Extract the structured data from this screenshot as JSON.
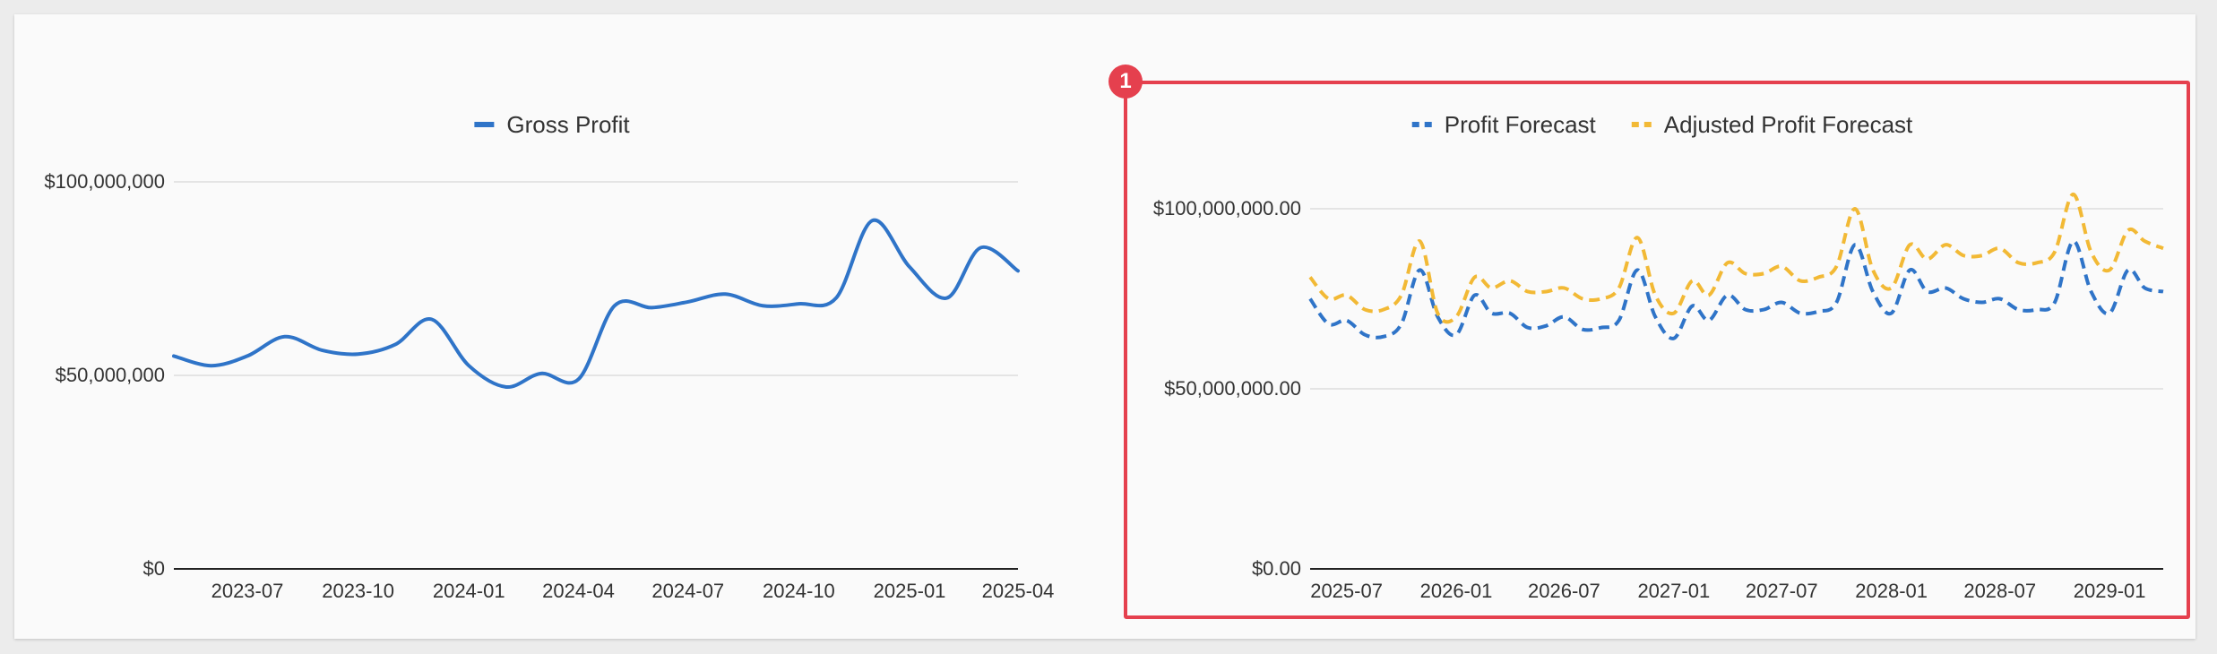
{
  "colors": {
    "gross_profit": "#2f74c8",
    "profit_forecast": "#2f74c8",
    "adjusted_profit_forecast": "#f2b935",
    "highlight": "#e5404e",
    "grid": "#dcdcdc",
    "axis": "#222222"
  },
  "highlight": {
    "badge": "1"
  },
  "chart_data": [
    {
      "type": "line",
      "legend_position": "top-center",
      "grid": true,
      "x_axis_type": "date",
      "x_ticks": [
        "2023-07",
        "2023-10",
        "2024-01",
        "2024-04",
        "2024-07",
        "2024-10",
        "2025-01",
        "2025-04"
      ],
      "y_ticks": [
        "$0",
        "$50,000,000",
        "$100,000,000"
      ],
      "ylim": [
        0,
        100000000
      ],
      "series": [
        {
          "name": "Gross Profit",
          "style": "solid",
          "color": "#2f74c8",
          "x": [
            "2023-05-01",
            "2023-06-01",
            "2023-07-01",
            "2023-08-01",
            "2023-09-01",
            "2023-10-01",
            "2023-11-01",
            "2023-12-01",
            "2024-01-01",
            "2024-02-01",
            "2024-03-01",
            "2024-04-01",
            "2024-05-01",
            "2024-06-01",
            "2024-07-01",
            "2024-08-01",
            "2024-09-01",
            "2024-10-01",
            "2024-11-01",
            "2024-12-01",
            "2025-01-01",
            "2025-02-01",
            "2025-03-01",
            "2025-04-01"
          ],
          "values": [
            55000000,
            52500000,
            55000000,
            60000000,
            56500000,
            55500000,
            58000000,
            64500000,
            52500000,
            47000000,
            50500000,
            49000000,
            68000000,
            67500000,
            69000000,
            71000000,
            68000000,
            68500000,
            70000000,
            90000000,
            78000000,
            70000000,
            83000000,
            77000000
          ]
        }
      ]
    },
    {
      "type": "line",
      "legend_position": "top-center",
      "grid": true,
      "x_axis_type": "date",
      "x_ticks": [
        "2025-07",
        "2026-01",
        "2026-07",
        "2027-01",
        "2027-07",
        "2028-01",
        "2028-07",
        "2029-01"
      ],
      "y_ticks": [
        "$0.00",
        "$50,000,000.00",
        "$100,000,000.00"
      ],
      "ylim": [
        0,
        100000000
      ],
      "series": [
        {
          "name": "Profit Forecast",
          "style": "dashed",
          "color": "#2f74c8",
          "x": [
            "2025-05-01",
            "2025-06-01",
            "2025-07-01",
            "2025-08-01",
            "2025-09-01",
            "2025-10-01",
            "2025-11-01",
            "2025-12-01",
            "2026-01-01",
            "2026-02-01",
            "2026-03-01",
            "2026-04-01",
            "2026-05-01",
            "2026-06-01",
            "2026-07-01",
            "2026-08-01",
            "2026-09-01",
            "2026-10-01",
            "2026-11-01",
            "2026-12-01",
            "2027-01-01",
            "2027-02-01",
            "2027-03-01",
            "2027-04-01",
            "2027-05-01",
            "2027-06-01",
            "2027-07-01",
            "2027-08-01",
            "2027-09-01",
            "2027-10-01",
            "2027-11-01",
            "2027-12-01",
            "2028-01-01",
            "2028-02-01",
            "2028-03-01",
            "2028-04-01",
            "2028-05-01",
            "2028-06-01",
            "2028-07-01",
            "2028-08-01",
            "2028-09-01",
            "2028-10-01",
            "2028-11-01",
            "2028-12-01",
            "2029-01-01",
            "2029-02-01",
            "2029-03-01",
            "2029-04-01"
          ],
          "values": [
            75000000,
            68000000,
            69000000,
            65000000,
            64500000,
            68000000,
            83000000,
            70000000,
            65000000,
            76000000,
            71000000,
            71000000,
            67000000,
            67500000,
            70000000,
            66500000,
            67000000,
            69000000,
            83000000,
            70000000,
            64000000,
            73000000,
            69000000,
            76000000,
            72000000,
            72000000,
            74000000,
            71000000,
            71500000,
            74000000,
            90000000,
            77000000,
            71000000,
            83000000,
            77000000,
            78000000,
            75000000,
            74000000,
            75000000,
            72000000,
            72000000,
            74000000,
            91000000,
            77000000,
            71000000,
            83000000,
            78000000,
            77000000
          ]
        },
        {
          "name": "Adjusted Profit Forecast",
          "style": "dashed",
          "color": "#f2b935",
          "x": [
            "2025-05-01",
            "2025-06-01",
            "2025-07-01",
            "2025-08-01",
            "2025-09-01",
            "2025-10-01",
            "2025-11-01",
            "2025-12-01",
            "2026-01-01",
            "2026-02-01",
            "2026-03-01",
            "2026-04-01",
            "2026-05-01",
            "2026-06-01",
            "2026-07-01",
            "2026-08-01",
            "2026-09-01",
            "2026-10-01",
            "2026-11-01",
            "2026-12-01",
            "2027-01-01",
            "2027-02-01",
            "2027-03-01",
            "2027-04-01",
            "2027-05-01",
            "2027-06-01",
            "2027-07-01",
            "2027-08-01",
            "2027-09-01",
            "2027-10-01",
            "2027-11-01",
            "2027-12-01",
            "2028-01-01",
            "2028-02-01",
            "2028-03-01",
            "2028-04-01",
            "2028-05-01",
            "2028-06-01",
            "2028-07-01",
            "2028-08-01",
            "2028-09-01",
            "2028-10-01",
            "2028-11-01",
            "2028-12-01",
            "2029-01-01",
            "2029-02-01",
            "2029-03-01",
            "2029-04-01"
          ],
          "values": [
            81000000,
            75000000,
            76000000,
            72000000,
            72000000,
            76000000,
            91000000,
            71000000,
            70000000,
            81000000,
            78000000,
            80000000,
            77000000,
            77000000,
            78000000,
            75000000,
            75000000,
            78000000,
            92000000,
            76000000,
            71000000,
            80000000,
            76000000,
            85000000,
            82000000,
            82000000,
            84000000,
            80000000,
            81000000,
            84000000,
            100000000,
            83000000,
            78000000,
            90000000,
            86000000,
            90000000,
            87000000,
            87000000,
            89000000,
            85000000,
            85000000,
            88000000,
            104000000,
            88000000,
            83000000,
            94000000,
            91000000,
            89000000
          ]
        }
      ]
    }
  ]
}
